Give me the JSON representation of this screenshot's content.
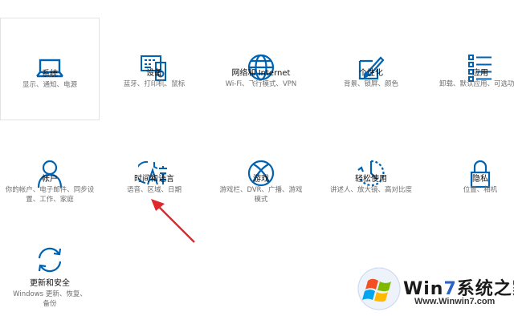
{
  "tiles": [
    {
      "id": "system",
      "title": "系统",
      "desc": "显示、通知、电源",
      "icon": "laptop-icon"
    },
    {
      "id": "devices",
      "title": "设备",
      "desc": "蓝牙、打印机、鼠标",
      "icon": "keyboard-speaker-icon"
    },
    {
      "id": "network",
      "title": "网络和 Internet",
      "desc": "Wi-Fi、飞行模式、VPN",
      "icon": "globe-icon"
    },
    {
      "id": "personalization",
      "title": "个性化",
      "desc": "背景、锁屏、颜色",
      "icon": "paint-tablet-icon"
    },
    {
      "id": "apps",
      "title": "应用",
      "desc": "卸载、默认应用、可选功能",
      "icon": "app-list-icon"
    },
    {
      "id": "accounts",
      "title": "帐户",
      "desc": "你的帐户、电子邮件、同步设置、工作、家庭",
      "icon": "person-icon"
    },
    {
      "id": "time-language",
      "title": "时间和语言",
      "desc": "语音、区域、日期",
      "icon": "time-language-icon"
    },
    {
      "id": "gaming",
      "title": "游戏",
      "desc": "游戏栏、DVR、广播、游戏模式",
      "icon": "xbox-icon"
    },
    {
      "id": "ease-of-access",
      "title": "轻松使用",
      "desc": "讲述人、放大镜、高对比度",
      "icon": "ease-of-access-icon"
    },
    {
      "id": "privacy",
      "title": "隐私",
      "desc": "位置、相机",
      "icon": "lock-icon"
    },
    {
      "id": "update-security",
      "title": "更新和安全",
      "desc": "Windows 更新、恢复、备份",
      "icon": "sync-arrows-icon"
    }
  ],
  "watermark": {
    "brand_prefix": "Win",
    "brand_highlight": "7",
    "brand_suffix": "系统之家",
    "url": "Www.Winwin7.com"
  },
  "colors": {
    "icon_blue": "#0063b1",
    "arrow_red": "#e0282c"
  }
}
